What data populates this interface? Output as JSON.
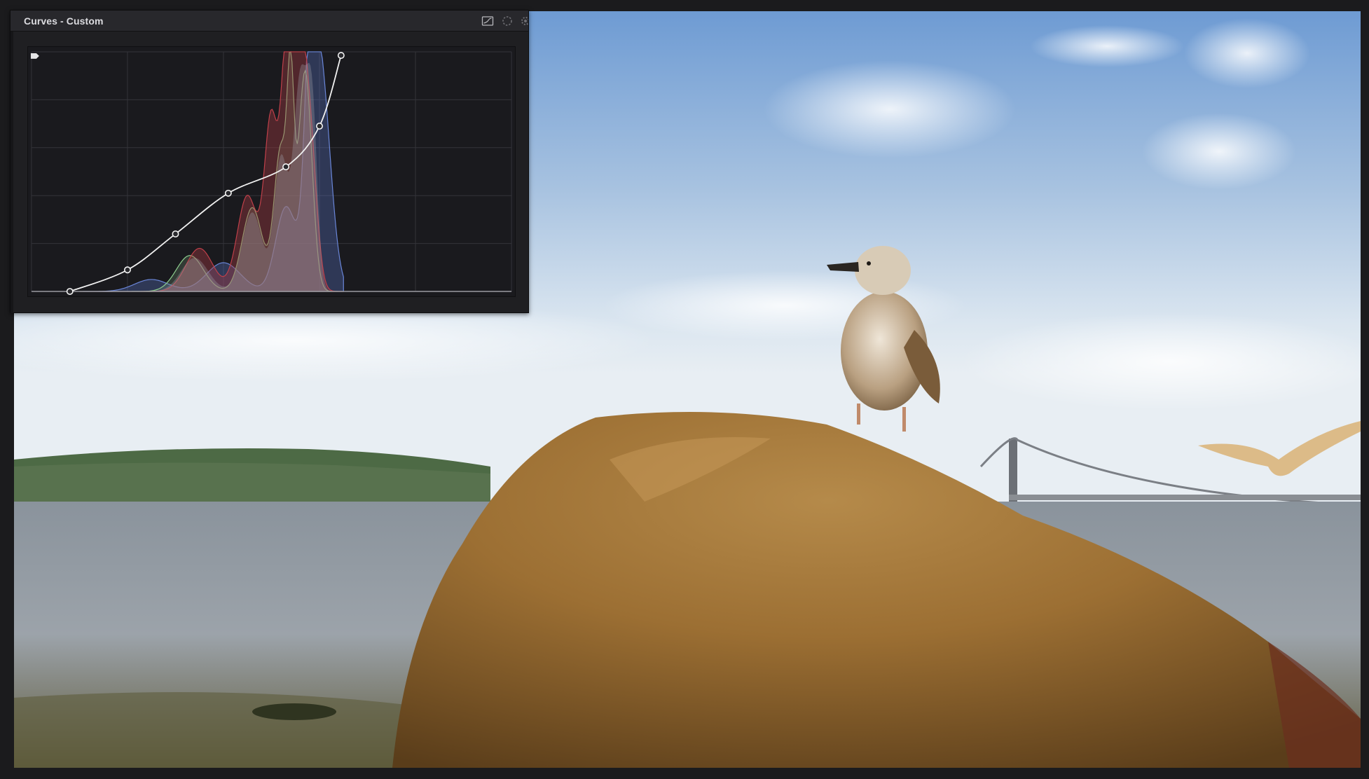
{
  "panel": {
    "title": "Curves - Custom"
  },
  "header_icons": [
    "graph-view-icon",
    "loading-spinner-icon",
    "settings-icon"
  ],
  "curve": {
    "control_points": [
      [
        0.08,
        0.0
      ],
      [
        0.2,
        0.09
      ],
      [
        0.3,
        0.24
      ],
      [
        0.41,
        0.41
      ],
      [
        0.53,
        0.52
      ],
      [
        0.6,
        0.69
      ],
      [
        0.645,
        0.985
      ]
    ]
  },
  "histogram": {
    "colors": {
      "red": "#c0404a",
      "green": "#8fd08f",
      "blue": "#6a86d8"
    }
  },
  "colors": {
    "panel_bg": "#1f1f22",
    "header_bg": "#28282c",
    "curve_line": "#f2f2f2"
  }
}
